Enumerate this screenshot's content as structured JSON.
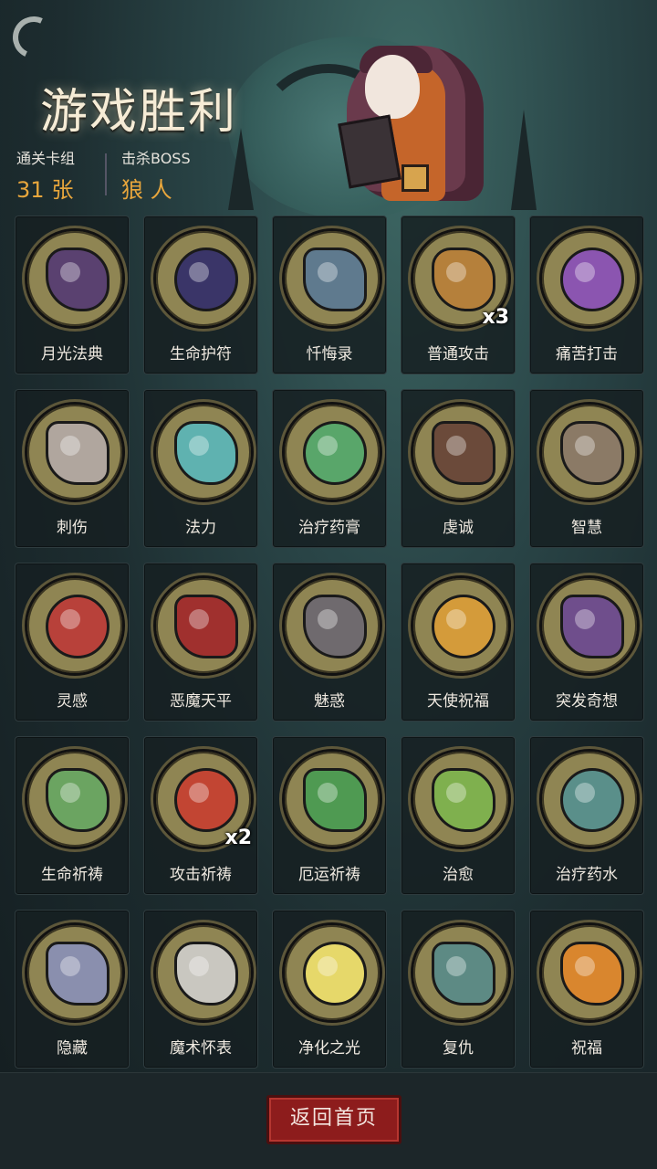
{
  "header": {
    "title": "游戏胜利",
    "deck_label": "通关卡组",
    "deck_count": "31",
    "deck_unit": "张",
    "boss_label": "击杀BOSS",
    "boss_name": "狼 人"
  },
  "cards": [
    {
      "name": "月光法典",
      "icon": "moonlight-tome-icon",
      "color": "#5a4170",
      "mult": ""
    },
    {
      "name": "生命护符",
      "icon": "bat-amulet-icon",
      "color": "#3a3568",
      "mult": ""
    },
    {
      "name": "忏悔录",
      "icon": "confession-book-icon",
      "color": "#5f7a8e",
      "mult": ""
    },
    {
      "name": "普通攻击",
      "icon": "attack-book-icon",
      "color": "#b5803b",
      "mult": "x3"
    },
    {
      "name": "痛苦打击",
      "icon": "pain-strike-icon",
      "color": "#8b55b0",
      "mult": ""
    },
    {
      "name": "刺伤",
      "icon": "dagger-icon",
      "color": "#b0a69e",
      "mult": ""
    },
    {
      "name": "法力",
      "icon": "mana-orb-icon",
      "color": "#5fb2b0",
      "mult": ""
    },
    {
      "name": "治疗药膏",
      "icon": "healing-ointment-icon",
      "color": "#59a66a",
      "mult": ""
    },
    {
      "name": "虔诚",
      "icon": "praying-monk-icon",
      "color": "#6b4a3a",
      "mult": ""
    },
    {
      "name": "智慧",
      "icon": "sage-icon",
      "color": "#8b7a66",
      "mult": ""
    },
    {
      "name": "灵感",
      "icon": "brain-skull-icon",
      "color": "#b8413a",
      "mult": ""
    },
    {
      "name": "恶魔天平",
      "icon": "demon-scale-icon",
      "color": "#a0302e",
      "mult": ""
    },
    {
      "name": "魅惑",
      "icon": "charm-icon",
      "color": "#6f6a6e",
      "mult": ""
    },
    {
      "name": "天使祝福",
      "icon": "angel-crown-icon",
      "color": "#d49b3a",
      "mult": ""
    },
    {
      "name": "突发奇想",
      "icon": "mad-scientist-icon",
      "color": "#6f4e8c",
      "mult": ""
    },
    {
      "name": "生命祈祷",
      "icon": "life-sprout-icon",
      "color": "#6ba461",
      "mult": ""
    },
    {
      "name": "攻击祈祷",
      "icon": "attack-prayer-icon",
      "color": "#c24533",
      "mult": "x2"
    },
    {
      "name": "厄运祈祷",
      "icon": "doom-cloud-icon",
      "color": "#4f9a52",
      "mult": ""
    },
    {
      "name": "治愈",
      "icon": "healing-plant-icon",
      "color": "#7fb04e",
      "mult": ""
    },
    {
      "name": "治疗药水",
      "icon": "potion-cauldron-icon",
      "color": "#5a8f8a",
      "mult": ""
    },
    {
      "name": "隐藏",
      "icon": "hiding-goblin-icon",
      "color": "#8a8fae",
      "mult": ""
    },
    {
      "name": "魔术怀表",
      "icon": "pocket-watch-icon",
      "color": "#c9c7c0",
      "mult": ""
    },
    {
      "name": "净化之光",
      "icon": "purifying-light-icon",
      "color": "#e6d86a",
      "mult": ""
    },
    {
      "name": "复仇",
      "icon": "revenge-zombie-icon",
      "color": "#5d8a84",
      "mult": ""
    },
    {
      "name": "祝福",
      "icon": "blessed-warrior-icon",
      "color": "#d9862e",
      "mult": ""
    }
  ],
  "footer": {
    "home_label": "返回首页"
  }
}
